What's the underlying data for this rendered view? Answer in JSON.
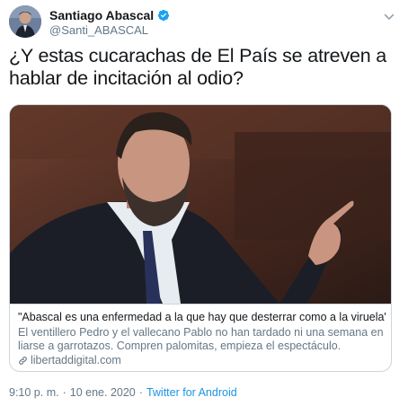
{
  "author": {
    "display_name": "Santiago Abascal",
    "handle": "@Santi_ABASCAL",
    "verified": true
  },
  "tweet": {
    "text": "¿Y estas cucarachas de El País se atreven a hablar de incitación al odio?"
  },
  "card": {
    "title": "\"Abascal es una enfermedad a la que hay que desterrar como a la viruela\"",
    "description": "El ventillero Pedro y el vallecano Pablo no han tardado ni una semana en liarse a garrotazos. Compren palomitas, empieza el espectáculo.",
    "domain": "libertaddigital.com"
  },
  "meta": {
    "time": "9:10 p. m.",
    "separator1": "·",
    "date": "10 ene. 2020",
    "separator2": "·",
    "source": "Twitter for Android"
  },
  "colors": {
    "link": "#1b95e0",
    "secondary_text": "#657786",
    "verified": "#1da1f2",
    "border": "#ccd6dd"
  },
  "icons": [
    "verified-badge-icon",
    "chevron-down-icon",
    "link-icon"
  ]
}
